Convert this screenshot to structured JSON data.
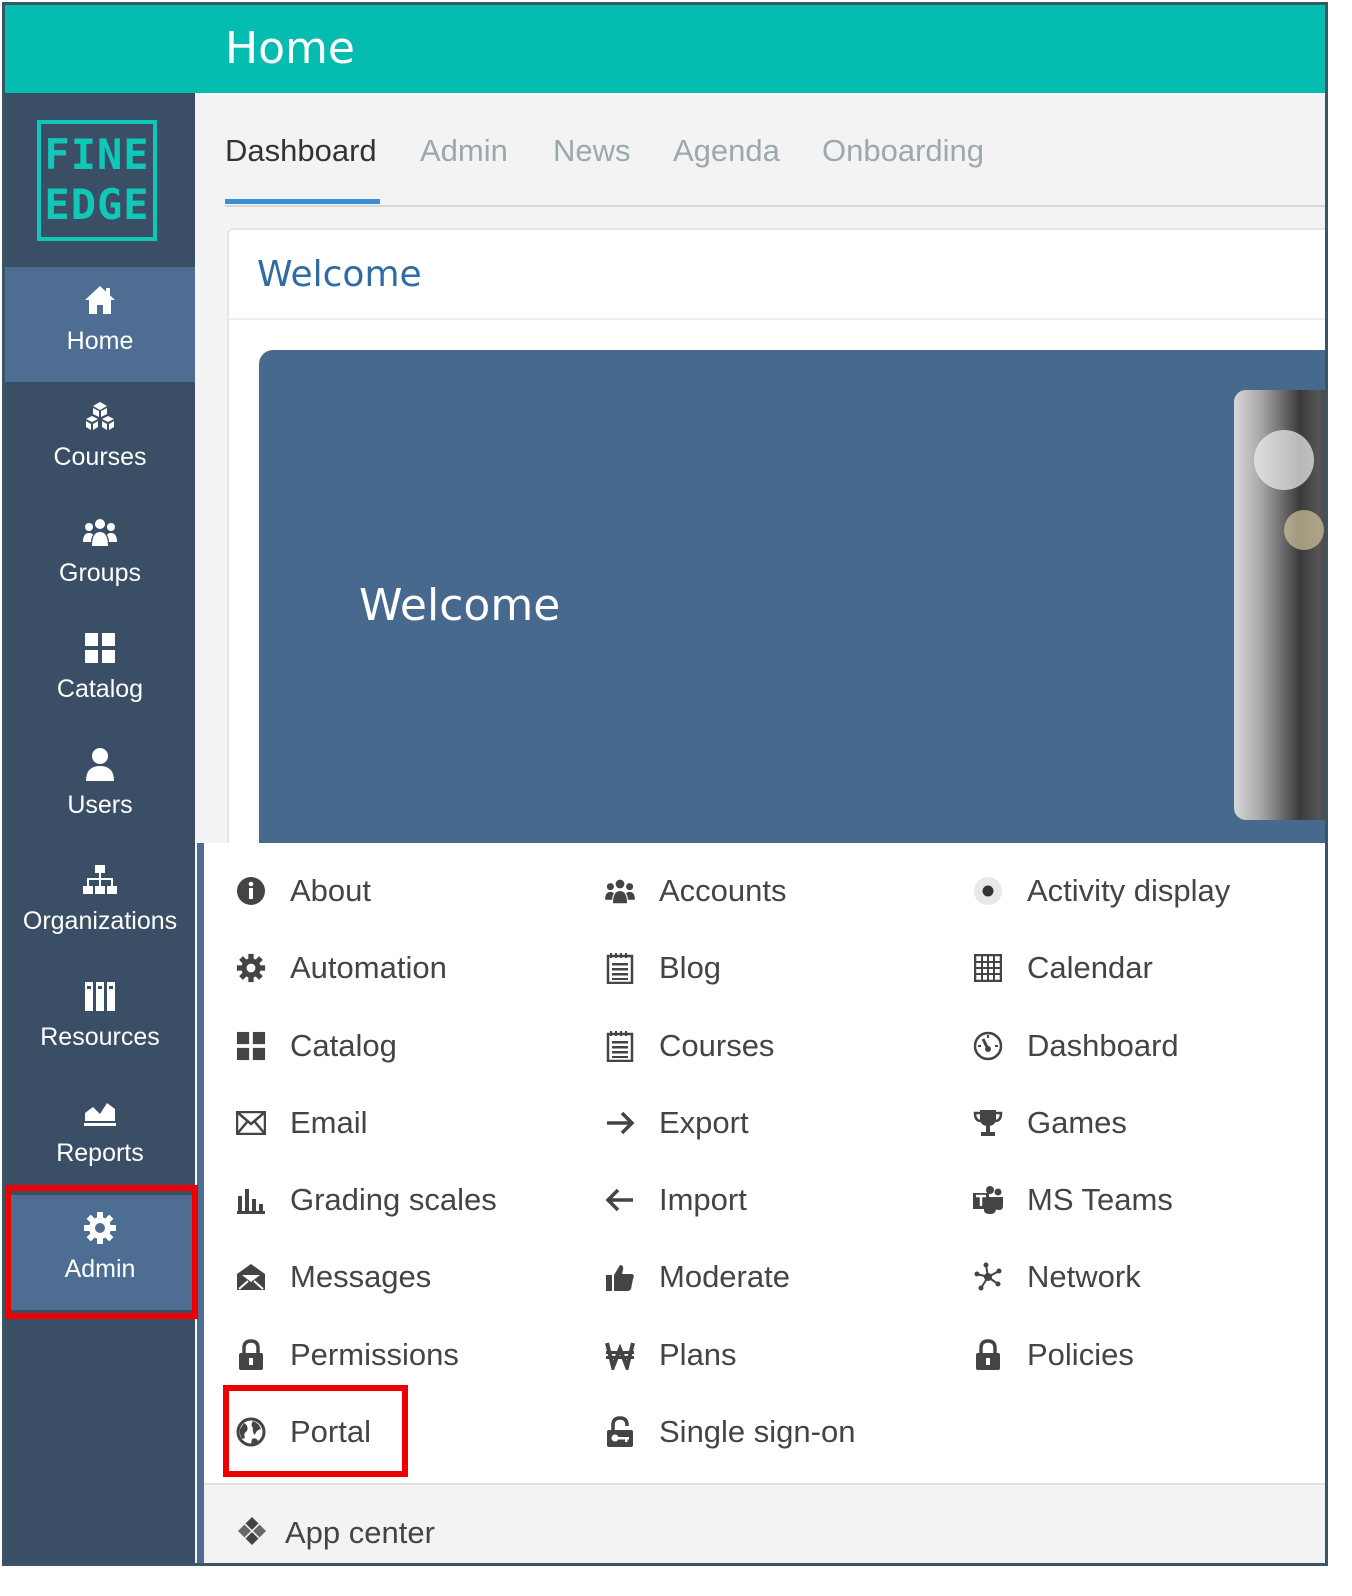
{
  "header": {
    "title": "Home"
  },
  "brand": {
    "line1": "FINE",
    "line2": "EDGE"
  },
  "sidebar": {
    "items": [
      {
        "label": "Home",
        "icon": "home-icon",
        "active": true
      },
      {
        "label": "Courses",
        "icon": "cubes-icon"
      },
      {
        "label": "Groups",
        "icon": "group-icon"
      },
      {
        "label": "Catalog",
        "icon": "grid-icon"
      },
      {
        "label": "Users",
        "icon": "user-icon"
      },
      {
        "label": "Organizations",
        "icon": "sitemap-icon"
      },
      {
        "label": "Resources",
        "icon": "books-icon"
      },
      {
        "label": "Reports",
        "icon": "area-chart-icon"
      },
      {
        "label": "Admin",
        "icon": "gear-icon",
        "active": true
      }
    ]
  },
  "tabs": [
    {
      "label": "Dashboard",
      "active": true
    },
    {
      "label": "Admin"
    },
    {
      "label": "News"
    },
    {
      "label": "Agenda"
    },
    {
      "label": "Onboarding"
    }
  ],
  "card": {
    "title": "Welcome",
    "banner_text": "Welcome"
  },
  "admin_menu": {
    "items": [
      {
        "label": "About",
        "icon": "info-icon"
      },
      {
        "label": "Accounts",
        "icon": "group-icon"
      },
      {
        "label": "Activity display",
        "icon": "radio-dot-icon"
      },
      {
        "label": "Automation",
        "icon": "cog-icon"
      },
      {
        "label": "Blog",
        "icon": "notepad-icon"
      },
      {
        "label": "Calendar",
        "icon": "calendar-grid-icon"
      },
      {
        "label": "Catalog",
        "icon": "grid-icon"
      },
      {
        "label": "Courses",
        "icon": "notepad-icon"
      },
      {
        "label": "Dashboard",
        "icon": "gauge-icon"
      },
      {
        "label": "Email",
        "icon": "envelope-icon"
      },
      {
        "label": "Export",
        "icon": "arrow-right-icon"
      },
      {
        "label": "Games",
        "icon": "trophy-icon"
      },
      {
        "label": "Grading scales",
        "icon": "bar-chart-icon"
      },
      {
        "label": "Import",
        "icon": "arrow-left-icon"
      },
      {
        "label": "MS Teams",
        "icon": "ms-teams-icon"
      },
      {
        "label": "Messages",
        "icon": "envelope-open-icon"
      },
      {
        "label": "Moderate",
        "icon": "thumbs-up-icon"
      },
      {
        "label": "Network",
        "icon": "network-icon"
      },
      {
        "label": "Permissions",
        "icon": "lock-icon"
      },
      {
        "label": "Plans",
        "icon": "won-icon"
      },
      {
        "label": "Policies",
        "icon": "lock-icon"
      },
      {
        "label": "Portal",
        "icon": "globe-icon"
      },
      {
        "label": "Single sign-on",
        "icon": "unlock-key-icon"
      }
    ],
    "footer": {
      "label": "App center",
      "icon": "app-center-icon"
    }
  },
  "colors": {
    "topbar": "#04bdb0",
    "sidebar": "#3a4f65",
    "active": "#4d6d92",
    "tab_accent": "#3b8ed3",
    "highlight": "#ee0000"
  }
}
